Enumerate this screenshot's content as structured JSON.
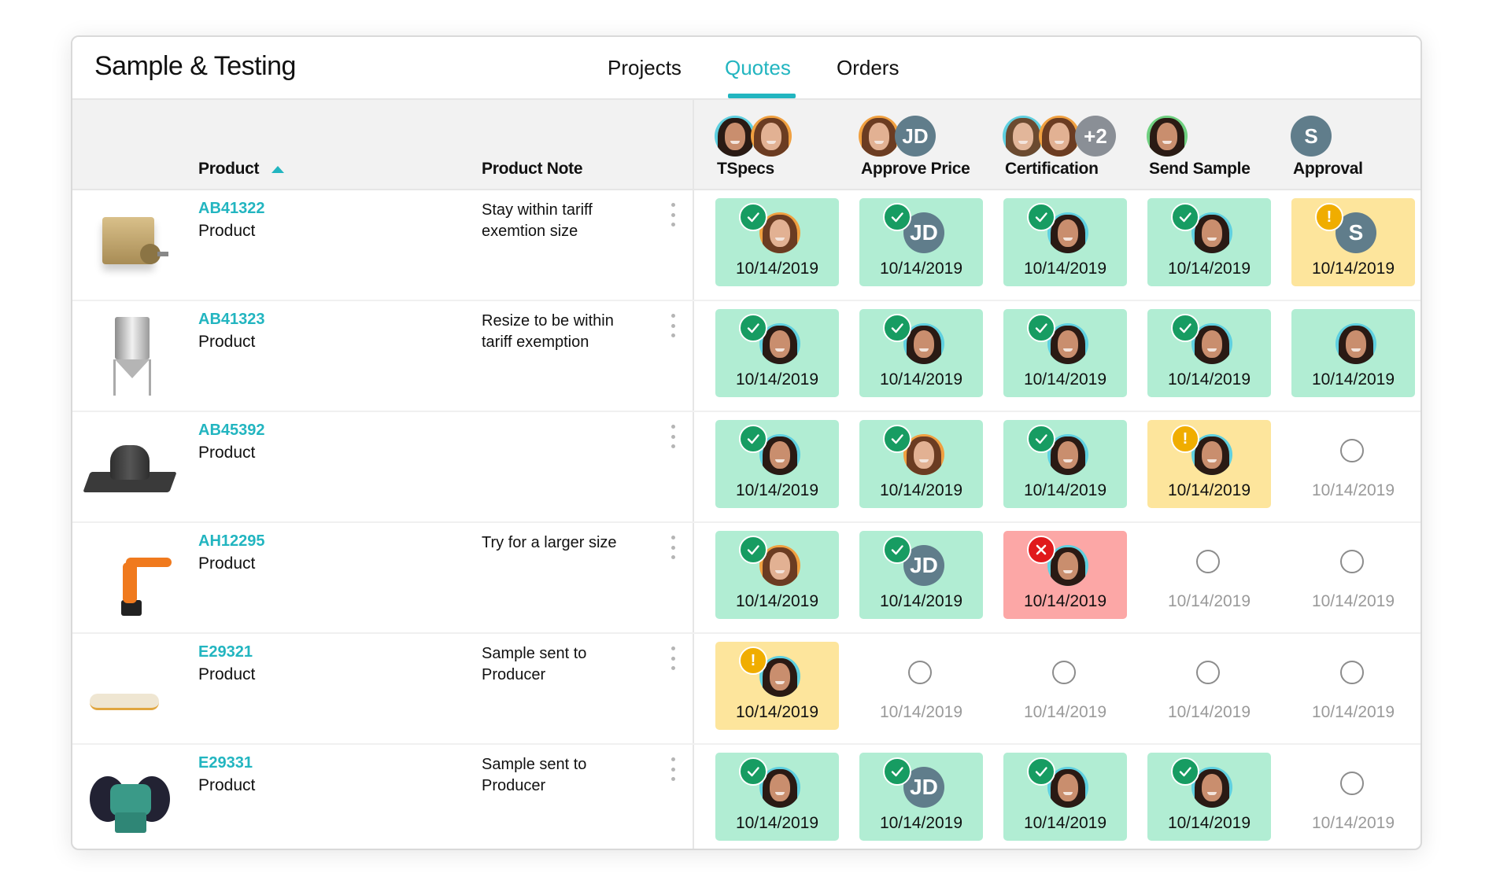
{
  "app": {
    "title": "Sample & Testing"
  },
  "tabs": [
    {
      "label": "Projects",
      "active": false
    },
    {
      "label": "Quotes",
      "active": true
    },
    {
      "label": "Orders",
      "active": false
    }
  ],
  "colors": {
    "accent": "#22b5c0",
    "done": "#b1edd3",
    "warn": "#fde59c",
    "fail": "#fca7a6",
    "badge_done": "#179c62",
    "badge_warn": "#f0ad00",
    "badge_fail": "#e0191c",
    "initials_avatar": "#607d8b",
    "more_avatar": "#8a8f96"
  },
  "table": {
    "product_header": "Product",
    "product_sort": "ascending",
    "note_header": "Product Note",
    "stages": [
      {
        "label": "TSpecs",
        "assignees": [
          {
            "type": "photo",
            "person": "woman-dark",
            "ring": "#5fd0e0"
          },
          {
            "type": "photo",
            "person": "woman-brown",
            "ring": "#f0a040"
          }
        ]
      },
      {
        "label": "Approve Price",
        "assignees": [
          {
            "type": "photo",
            "person": "woman-brown",
            "ring": "#f0a040"
          },
          {
            "type": "initials",
            "text": "JD"
          }
        ]
      },
      {
        "label": "Certification",
        "assignees": [
          {
            "type": "photo",
            "person": "man",
            "ring": "#5fd0e0"
          },
          {
            "type": "photo",
            "person": "woman-brown",
            "ring": "#f0a040"
          },
          {
            "type": "more",
            "text": "+2"
          }
        ]
      },
      {
        "label": "Send Sample",
        "assignees": [
          {
            "type": "photo",
            "person": "woman-dark",
            "ring": "#6fd080"
          }
        ]
      },
      {
        "label": "Approval",
        "assignees": [
          {
            "type": "initials",
            "text": "S"
          }
        ]
      }
    ],
    "rows": [
      {
        "id": "AB41322",
        "type": "Product",
        "note": "Stay within tariff exemtion size",
        "image": "motor",
        "cells": [
          {
            "status": "done",
            "assignee": "woman-brown",
            "date": "10/14/2019"
          },
          {
            "status": "done",
            "assignee": "JD",
            "date": "10/14/2019"
          },
          {
            "status": "done",
            "assignee": "woman-dark",
            "date": "10/14/2019"
          },
          {
            "status": "done",
            "assignee": "woman-dark",
            "date": "10/14/2019"
          },
          {
            "status": "warn",
            "assignee": "S",
            "date": "10/14/2019"
          }
        ]
      },
      {
        "id": "AB41323",
        "type": "Product",
        "note": "Resize to be within tariff exemption",
        "image": "tank",
        "cells": [
          {
            "status": "done",
            "assignee": "woman-dark",
            "date": "10/14/2019"
          },
          {
            "status": "done",
            "assignee": "woman-dark",
            "date": "10/14/2019"
          },
          {
            "status": "done",
            "assignee": "woman-dark",
            "date": "10/14/2019"
          },
          {
            "status": "done",
            "assignee": "woman-dark",
            "date": "10/14/2019"
          },
          {
            "status": "done-nobadge",
            "assignee": "woman-dark",
            "date": "10/14/2019"
          }
        ]
      },
      {
        "id": "AB45392",
        "type": "Product",
        "note": "",
        "image": "flange",
        "cells": [
          {
            "status": "done",
            "assignee": "woman-dark",
            "date": "10/14/2019"
          },
          {
            "status": "done",
            "assignee": "woman-brown",
            "date": "10/14/2019"
          },
          {
            "status": "done",
            "assignee": "woman-dark",
            "date": "10/14/2019"
          },
          {
            "status": "warn",
            "assignee": "woman-dark",
            "date": "10/14/2019"
          },
          {
            "status": "pending",
            "date": "10/14/2019"
          }
        ]
      },
      {
        "id": "AH12295",
        "type": "Product",
        "note": "Try for a larger size",
        "image": "robot",
        "cells": [
          {
            "status": "done",
            "assignee": "woman-brown",
            "date": "10/14/2019"
          },
          {
            "status": "done",
            "assignee": "JD",
            "date": "10/14/2019"
          },
          {
            "status": "fail",
            "assignee": "woman-dark",
            "date": "10/14/2019"
          },
          {
            "status": "pending",
            "date": "10/14/2019"
          },
          {
            "status": "pending",
            "date": "10/14/2019"
          }
        ]
      },
      {
        "id": "E29321",
        "type": "Product",
        "note": "Sample sent to Producer",
        "image": "gloves",
        "cells": [
          {
            "status": "warn",
            "assignee": "woman-dark",
            "date": "10/14/2019"
          },
          {
            "status": "pending",
            "date": "10/14/2019"
          },
          {
            "status": "pending",
            "date": "10/14/2019"
          },
          {
            "status": "pending",
            "date": "10/14/2019"
          },
          {
            "status": "pending",
            "date": "10/14/2019"
          }
        ]
      },
      {
        "id": "E29331",
        "type": "Product",
        "note": "Sample sent to Producer",
        "image": "grinder",
        "cells": [
          {
            "status": "done",
            "assignee": "woman-dark",
            "date": "10/14/2019"
          },
          {
            "status": "done",
            "assignee": "JD",
            "date": "10/14/2019"
          },
          {
            "status": "done",
            "assignee": "woman-dark",
            "date": "10/14/2019"
          },
          {
            "status": "done",
            "assignee": "woman-dark",
            "date": "10/14/2019"
          },
          {
            "status": "pending",
            "date": "10/14/2019"
          }
        ]
      }
    ]
  }
}
